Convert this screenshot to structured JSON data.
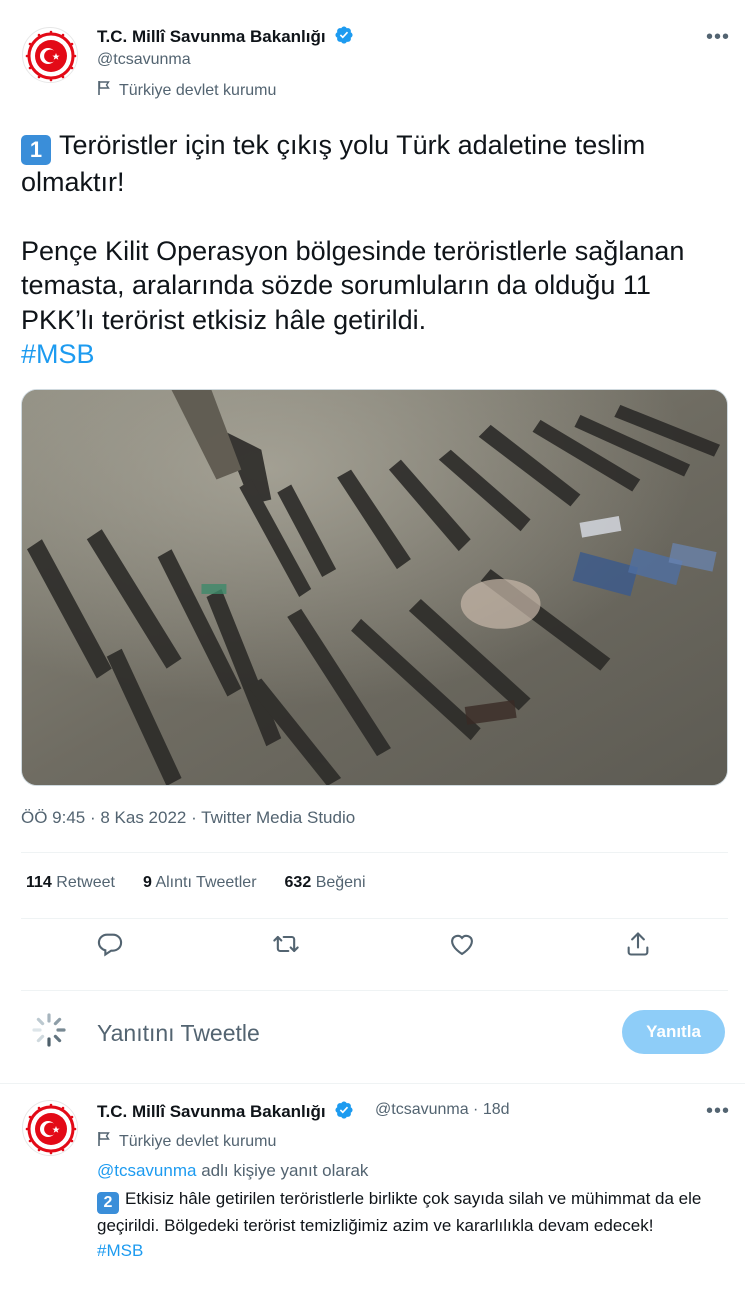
{
  "main_tweet": {
    "author_name": "T.C. Millî Savunma Bakanlığı",
    "handle": "@tcsavunma",
    "label": "Türkiye devlet kurumu",
    "badge": "1",
    "line1": "Teröristler için tek çıkış yolu Türk adaletine teslim olmaktır!",
    "line2": "Pençe Kilit Operasyon bölgesinde teröristlerle sağlanan temasta, aralarında sözde sorumluların da olduğu 11 PKK’lı terörist etkisiz hâle getirildi.",
    "hashtag": "#MSB",
    "meta": "ÖÖ 9:45 · 8 Kas 2022 · Twitter Media Studio",
    "stats": {
      "retweet_count": "114",
      "retweet_label": "Retweet",
      "quote_count": "9",
      "quote_label": "Alıntı Tweetler",
      "like_count": "632",
      "like_label": "Beğeni"
    }
  },
  "reply_box": {
    "placeholder": "Yanıtını Tweetle",
    "button": "Yanıtla"
  },
  "reply_tweet": {
    "author_name": "T.C. Millî Savunma Bakanlığı",
    "handle_time": "@tcsavunma · 18d",
    "label": "Türkiye devlet kurumu",
    "reply_to_handle": "@tcsavunma",
    "reply_to_text": " adlı kişiye yanıt olarak",
    "badge": "2",
    "text": "Etkisiz hâle getirilen teröristlerle birlikte çok sayıda  silah ve mühimmat da ele geçirildi. Bölgedeki terörist temizliğimiz azim ve kararlılıkla devam edecek!",
    "hashtag": "#MSB"
  },
  "icons": [
    "verified-badge-icon",
    "flag-icon",
    "more-icon",
    "reply-icon",
    "retweet-icon",
    "like-icon",
    "share-icon",
    "loading-spinner-icon"
  ],
  "colors": {
    "accent": "#1d9bf0",
    "muted": "#536471",
    "button_disabled": "#8ecdf8",
    "badge": "#3a8ed9"
  }
}
